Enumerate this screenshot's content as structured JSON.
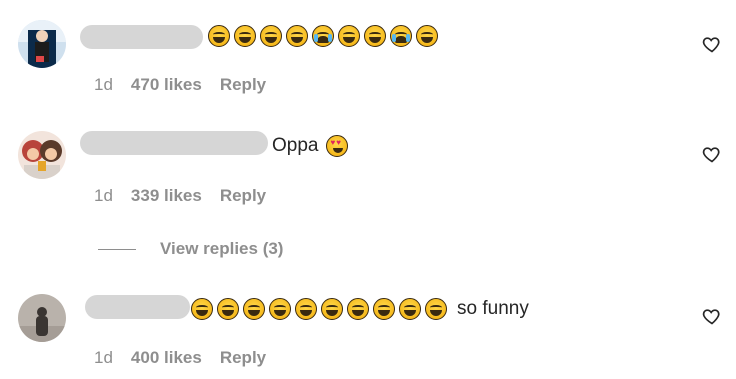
{
  "comments": [
    {
      "text": "",
      "emojis": [
        "laugh",
        "laugh",
        "laugh",
        "laugh",
        "cry",
        "laugh",
        "laugh",
        "cry",
        "laugh"
      ],
      "time": "1d",
      "likes": "470 likes",
      "reply": "Reply",
      "avatar_colors": [
        "#0b2a4a",
        "#c7d8e8"
      ]
    },
    {
      "text": "Oppa",
      "emojis": [
        "heart-eyes"
      ],
      "time": "1d",
      "likes": "339 likes",
      "reply": "Reply",
      "avatar_colors": [
        "#b8443b",
        "#f4c9a6"
      ]
    },
    {
      "text": "so funny",
      "emojis": [
        "laugh",
        "laugh",
        "laugh",
        "laugh",
        "laugh",
        "laugh",
        "laugh",
        "laugh",
        "laugh",
        "laugh"
      ],
      "time": "1d",
      "likes": "400 likes",
      "reply": "Reply",
      "avatar_colors": [
        "#9a8f86",
        "#5e5650"
      ]
    }
  ],
  "view_replies": "View replies (3)",
  "icons": {
    "like": "heart-outline-icon"
  }
}
